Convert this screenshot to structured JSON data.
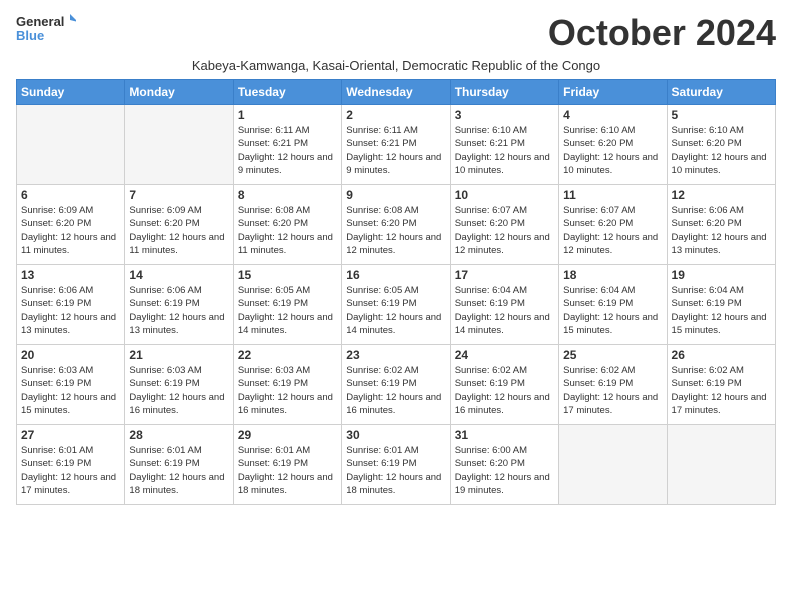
{
  "logo": {
    "line1": "General",
    "line2": "Blue",
    "icon_color": "#4a90d9"
  },
  "title": "October 2024",
  "subtitle": "Kabeya-Kamwanga, Kasai-Oriental, Democratic Republic of the Congo",
  "days_of_week": [
    "Sunday",
    "Monday",
    "Tuesday",
    "Wednesday",
    "Thursday",
    "Friday",
    "Saturday"
  ],
  "weeks": [
    [
      {
        "day": "",
        "info": ""
      },
      {
        "day": "",
        "info": ""
      },
      {
        "day": "1",
        "info": "Sunrise: 6:11 AM\nSunset: 6:21 PM\nDaylight: 12 hours and 9 minutes."
      },
      {
        "day": "2",
        "info": "Sunrise: 6:11 AM\nSunset: 6:21 PM\nDaylight: 12 hours and 9 minutes."
      },
      {
        "day": "3",
        "info": "Sunrise: 6:10 AM\nSunset: 6:21 PM\nDaylight: 12 hours and 10 minutes."
      },
      {
        "day": "4",
        "info": "Sunrise: 6:10 AM\nSunset: 6:20 PM\nDaylight: 12 hours and 10 minutes."
      },
      {
        "day": "5",
        "info": "Sunrise: 6:10 AM\nSunset: 6:20 PM\nDaylight: 12 hours and 10 minutes."
      }
    ],
    [
      {
        "day": "6",
        "info": "Sunrise: 6:09 AM\nSunset: 6:20 PM\nDaylight: 12 hours and 11 minutes."
      },
      {
        "day": "7",
        "info": "Sunrise: 6:09 AM\nSunset: 6:20 PM\nDaylight: 12 hours and 11 minutes."
      },
      {
        "day": "8",
        "info": "Sunrise: 6:08 AM\nSunset: 6:20 PM\nDaylight: 12 hours and 11 minutes."
      },
      {
        "day": "9",
        "info": "Sunrise: 6:08 AM\nSunset: 6:20 PM\nDaylight: 12 hours and 12 minutes."
      },
      {
        "day": "10",
        "info": "Sunrise: 6:07 AM\nSunset: 6:20 PM\nDaylight: 12 hours and 12 minutes."
      },
      {
        "day": "11",
        "info": "Sunrise: 6:07 AM\nSunset: 6:20 PM\nDaylight: 12 hours and 12 minutes."
      },
      {
        "day": "12",
        "info": "Sunrise: 6:06 AM\nSunset: 6:20 PM\nDaylight: 12 hours and 13 minutes."
      }
    ],
    [
      {
        "day": "13",
        "info": "Sunrise: 6:06 AM\nSunset: 6:19 PM\nDaylight: 12 hours and 13 minutes."
      },
      {
        "day": "14",
        "info": "Sunrise: 6:06 AM\nSunset: 6:19 PM\nDaylight: 12 hours and 13 minutes."
      },
      {
        "day": "15",
        "info": "Sunrise: 6:05 AM\nSunset: 6:19 PM\nDaylight: 12 hours and 14 minutes."
      },
      {
        "day": "16",
        "info": "Sunrise: 6:05 AM\nSunset: 6:19 PM\nDaylight: 12 hours and 14 minutes."
      },
      {
        "day": "17",
        "info": "Sunrise: 6:04 AM\nSunset: 6:19 PM\nDaylight: 12 hours and 14 minutes."
      },
      {
        "day": "18",
        "info": "Sunrise: 6:04 AM\nSunset: 6:19 PM\nDaylight: 12 hours and 15 minutes."
      },
      {
        "day": "19",
        "info": "Sunrise: 6:04 AM\nSunset: 6:19 PM\nDaylight: 12 hours and 15 minutes."
      }
    ],
    [
      {
        "day": "20",
        "info": "Sunrise: 6:03 AM\nSunset: 6:19 PM\nDaylight: 12 hours and 15 minutes."
      },
      {
        "day": "21",
        "info": "Sunrise: 6:03 AM\nSunset: 6:19 PM\nDaylight: 12 hours and 16 minutes."
      },
      {
        "day": "22",
        "info": "Sunrise: 6:03 AM\nSunset: 6:19 PM\nDaylight: 12 hours and 16 minutes."
      },
      {
        "day": "23",
        "info": "Sunrise: 6:02 AM\nSunset: 6:19 PM\nDaylight: 12 hours and 16 minutes."
      },
      {
        "day": "24",
        "info": "Sunrise: 6:02 AM\nSunset: 6:19 PM\nDaylight: 12 hours and 16 minutes."
      },
      {
        "day": "25",
        "info": "Sunrise: 6:02 AM\nSunset: 6:19 PM\nDaylight: 12 hours and 17 minutes."
      },
      {
        "day": "26",
        "info": "Sunrise: 6:02 AM\nSunset: 6:19 PM\nDaylight: 12 hours and 17 minutes."
      }
    ],
    [
      {
        "day": "27",
        "info": "Sunrise: 6:01 AM\nSunset: 6:19 PM\nDaylight: 12 hours and 17 minutes."
      },
      {
        "day": "28",
        "info": "Sunrise: 6:01 AM\nSunset: 6:19 PM\nDaylight: 12 hours and 18 minutes."
      },
      {
        "day": "29",
        "info": "Sunrise: 6:01 AM\nSunset: 6:19 PM\nDaylight: 12 hours and 18 minutes."
      },
      {
        "day": "30",
        "info": "Sunrise: 6:01 AM\nSunset: 6:19 PM\nDaylight: 12 hours and 18 minutes."
      },
      {
        "day": "31",
        "info": "Sunrise: 6:00 AM\nSunset: 6:20 PM\nDaylight: 12 hours and 19 minutes."
      },
      {
        "day": "",
        "info": ""
      },
      {
        "day": "",
        "info": ""
      }
    ]
  ]
}
